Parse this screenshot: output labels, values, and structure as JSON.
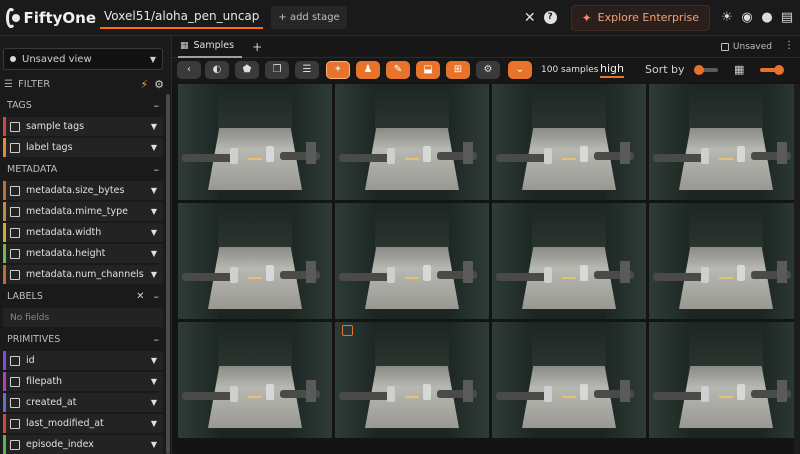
{
  "header": {
    "app_name": "FiftyOne",
    "dataset_name": "Voxel51/aloha_pen_uncap",
    "add_stage_label": "+ add stage",
    "explore_label": "Explore Enterprise"
  },
  "sidebar": {
    "view_select": "Unsaved view",
    "filter_label": "FILTER",
    "sections": {
      "tags": {
        "title": "TAGS",
        "items": [
          {
            "label": "sample tags",
            "color": "#d64545"
          },
          {
            "label": "label tags",
            "color": "#e08a3a"
          }
        ]
      },
      "metadata": {
        "title": "METADATA",
        "items": [
          {
            "label": "metadata.size_bytes",
            "color": "#c46a3a"
          },
          {
            "label": "metadata.mime_type",
            "color": "#c48a3a"
          },
          {
            "label": "metadata.width",
            "color": "#d1a73a"
          },
          {
            "label": "metadata.height",
            "color": "#7ab648"
          },
          {
            "label": "metadata.num_channels",
            "color": "#c46a3a"
          }
        ]
      },
      "labels": {
        "title": "LABELS",
        "empty_text": "No fields"
      },
      "primitives": {
        "title": "PRIMITIVES",
        "items": [
          {
            "label": "id",
            "color": "#7a4de0"
          },
          {
            "label": "filepath",
            "color": "#b040c0"
          },
          {
            "label": "created_at",
            "color": "#6a6ad0"
          },
          {
            "label": "last_modified_at",
            "color": "#d64545"
          },
          {
            "label": "episode_index",
            "color": "#5ab648"
          }
        ]
      }
    }
  },
  "tabs": {
    "samples_label": "Samples",
    "add_label": "+",
    "unsaved_label": "Unsaved"
  },
  "toolbar": {
    "count_label": "100 samples",
    "quality_label": "high",
    "sort_label": "Sort by",
    "accent_color": "#e8732b"
  }
}
